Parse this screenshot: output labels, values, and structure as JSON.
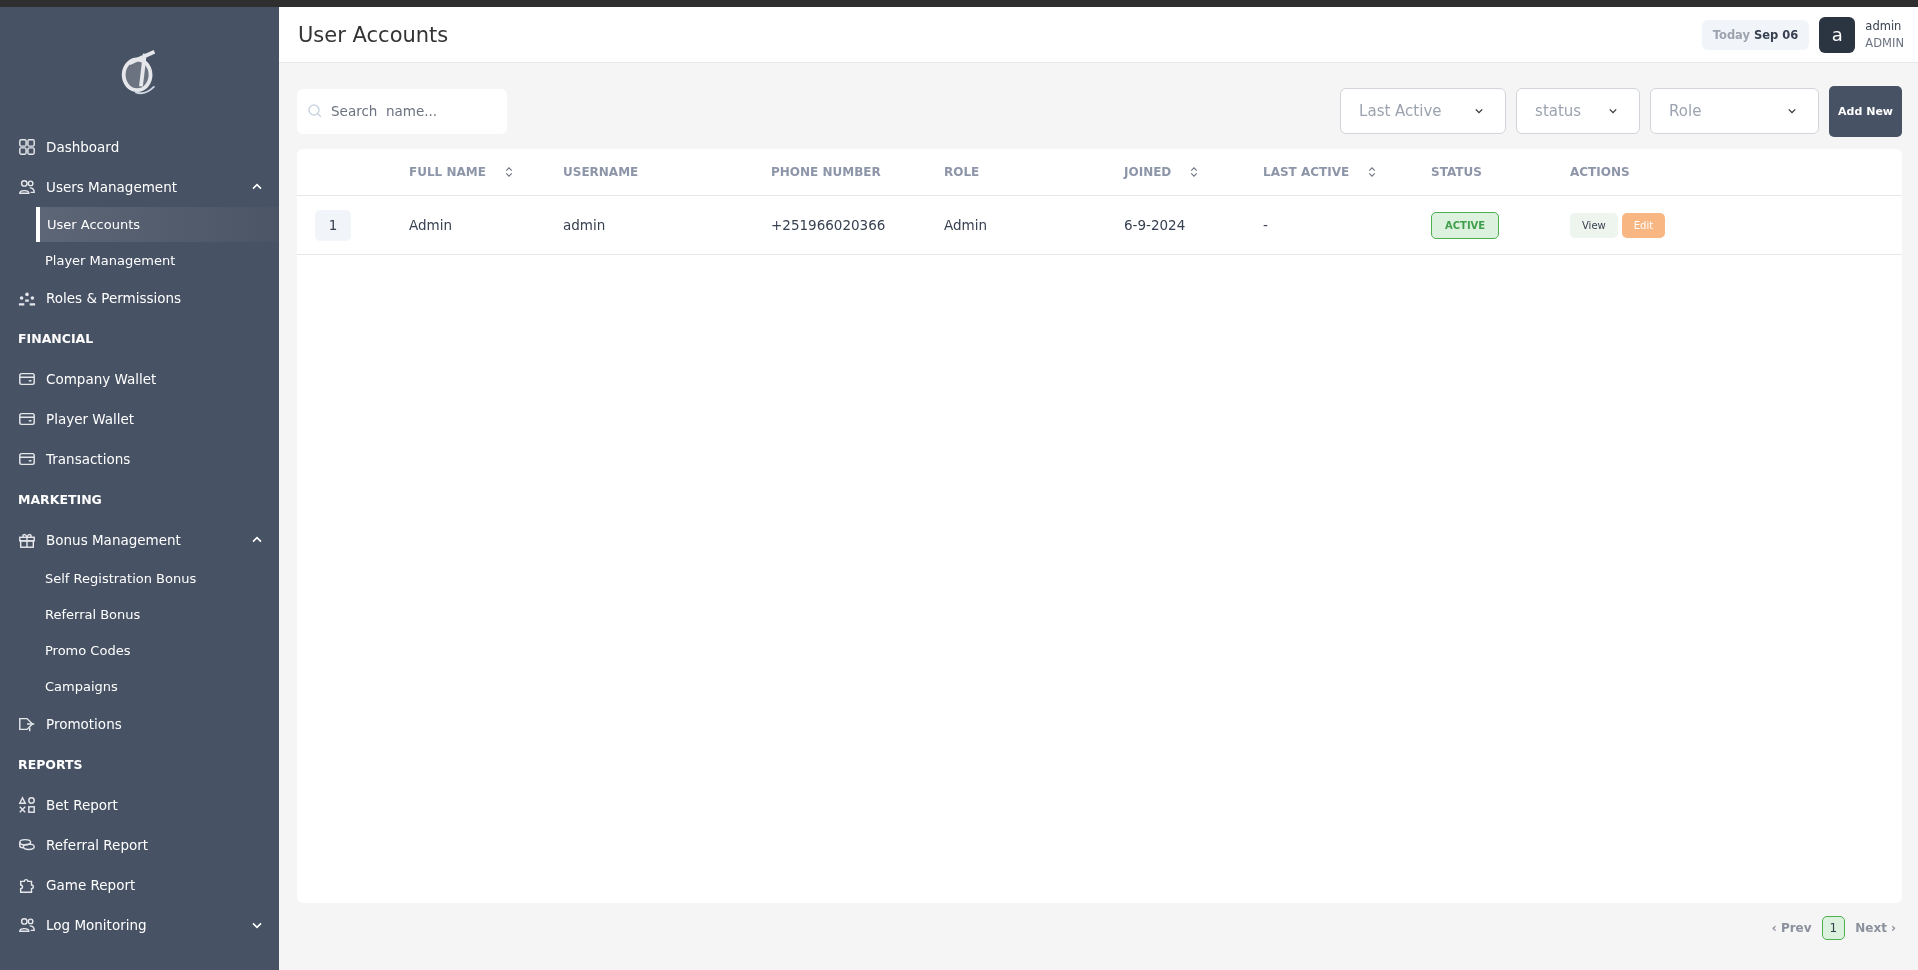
{
  "sidebar": {
    "items": [
      {
        "kind": "link",
        "label": "Dashboard",
        "selected": false
      },
      {
        "kind": "group",
        "label": "Users Management",
        "expanded": true,
        "children": [
          {
            "label": "User Accounts",
            "selected": true
          },
          {
            "label": "Player Management",
            "selected": false
          }
        ]
      },
      {
        "kind": "link",
        "label": "Roles & Permissions",
        "selected": false
      },
      {
        "kind": "header",
        "label": "FINANCIAL"
      },
      {
        "kind": "link",
        "label": "Company Wallet",
        "selected": false
      },
      {
        "kind": "link",
        "label": "Player Wallet",
        "selected": false
      },
      {
        "kind": "link",
        "label": "Transactions",
        "selected": false
      },
      {
        "kind": "header",
        "label": "MARKETING"
      },
      {
        "kind": "group",
        "label": "Bonus Management",
        "expanded": true,
        "children": [
          {
            "label": "Self Registration Bonus",
            "selected": false
          },
          {
            "label": "Referral Bonus",
            "selected": false
          },
          {
            "label": "Promo Codes",
            "selected": false
          },
          {
            "label": "Campaigns",
            "selected": false
          }
        ]
      },
      {
        "kind": "link",
        "label": "Promotions",
        "selected": false
      },
      {
        "kind": "header",
        "label": "REPORTS"
      },
      {
        "kind": "link",
        "label": "Bet Report",
        "selected": false
      },
      {
        "kind": "link",
        "label": "Referral Report",
        "selected": false
      },
      {
        "kind": "link",
        "label": "Game Report",
        "selected": false
      },
      {
        "kind": "group",
        "label": "Log Monitoring",
        "expanded": false
      }
    ]
  },
  "header": {
    "title": "User Accounts",
    "date_label": "Today",
    "date": "Sep 06",
    "avatar_letter": "a",
    "user_name": "admin",
    "user_role": "ADMIN"
  },
  "toolbar": {
    "search": {
      "placeholder": "Search  name..."
    },
    "filters": [
      {
        "placeholder": "Last Active"
      },
      {
        "placeholder": "status"
      },
      {
        "placeholder": "Role"
      }
    ],
    "add_button": "Add New"
  },
  "table": {
    "columns": [
      {
        "label": "FULL NAME",
        "sortable": true
      },
      {
        "label": "USERNAME",
        "sortable": false
      },
      {
        "label": "PHONE NUMBER",
        "sortable": false
      },
      {
        "label": "ROLE",
        "sortable": false
      },
      {
        "label": "JOINED",
        "sortable": true
      },
      {
        "label": "LAST ACTIVE",
        "sortable": true
      },
      {
        "label": "STATUS",
        "sortable": false
      },
      {
        "label": "ACTIONS",
        "sortable": false
      }
    ],
    "rows": [
      {
        "index": "1",
        "full_name": "Admin",
        "username": "admin",
        "phone": "+251966020366",
        "role": "Admin",
        "joined": "6-9-2024",
        "last_active": "-",
        "status": "ACTIVE",
        "actions": [
          "View",
          "Edit"
        ]
      }
    ]
  },
  "pagination": {
    "prev": "‹ Prev",
    "pages": [
      {
        "label": "1",
        "selected": true
      }
    ],
    "next": "Next ›"
  }
}
